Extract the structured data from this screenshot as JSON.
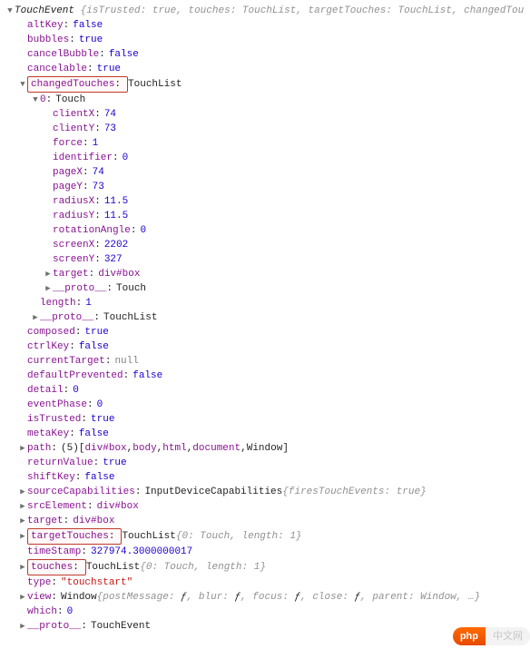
{
  "header": {
    "class": "TouchEvent",
    "preview_pairs": [
      {
        "k": "isTrusted",
        "v": "true"
      },
      {
        "k": "touches",
        "v": "TouchList"
      },
      {
        "k": "targetTouches",
        "v": "TouchList"
      },
      {
        "k": "changedTou",
        "v": ""
      }
    ]
  },
  "props": {
    "altKey": "false",
    "bubbles": "true",
    "cancelBubble": "false",
    "cancelable": "true"
  },
  "changedTouches": {
    "label": "changedTouches",
    "type": "TouchList",
    "item": {
      "index": "0",
      "itemType": "Touch",
      "clientX": "74",
      "clientY": "73",
      "force": "1",
      "identifier": "0",
      "pageX": "74",
      "pageY": "73",
      "radiusX": "11.5",
      "radiusY": "11.5",
      "rotationAngle": "0",
      "screenX": "2202",
      "screenY": "327",
      "target": "div#box",
      "protoType": "Touch"
    },
    "length": "1",
    "protoType": "TouchList"
  },
  "props2": {
    "composed": "true",
    "ctrlKey": "false",
    "currentTarget": "null",
    "defaultPrevented": "false",
    "detail": "0",
    "eventPhase": "0",
    "isTrusted": "true",
    "metaKey": "false"
  },
  "path": {
    "label": "path",
    "count": "(5)",
    "items": [
      "div#box",
      "body",
      "html",
      "document",
      "Window"
    ]
  },
  "props3": {
    "returnValue": "true",
    "shiftKey": "false"
  },
  "sourceCapabilities": {
    "label": "sourceCapabilities",
    "type": "InputDeviceCapabilities",
    "preview_k": "firesTouchEvents",
    "preview_v": "true"
  },
  "srcElement": {
    "label": "srcElement",
    "value": "div#box"
  },
  "target": {
    "label": "target",
    "value": "div#box"
  },
  "targetTouches": {
    "label": "targetTouches",
    "type": "TouchList",
    "preview_idx": "0",
    "preview_val": "Touch",
    "length_k": "length",
    "length_v": "1"
  },
  "timeStamp": {
    "label": "timeStamp",
    "value": "327974.3000000017"
  },
  "touches": {
    "label": "touches",
    "type": "TouchList",
    "preview_idx": "0",
    "preview_val": "Touch",
    "length_k": "length",
    "length_v": "1"
  },
  "type": {
    "label": "type",
    "value": "\"touchstart\""
  },
  "view": {
    "label": "view",
    "type": "Window",
    "fns": [
      "postMessage",
      "blur",
      "focus",
      "close"
    ],
    "parent_k": "parent",
    "parent_v": "Window"
  },
  "which": {
    "label": "which",
    "value": "0"
  },
  "proto": {
    "label": "__proto__",
    "value": "TouchEvent"
  },
  "watermark": {
    "pill": "php",
    "text": "中文网"
  }
}
